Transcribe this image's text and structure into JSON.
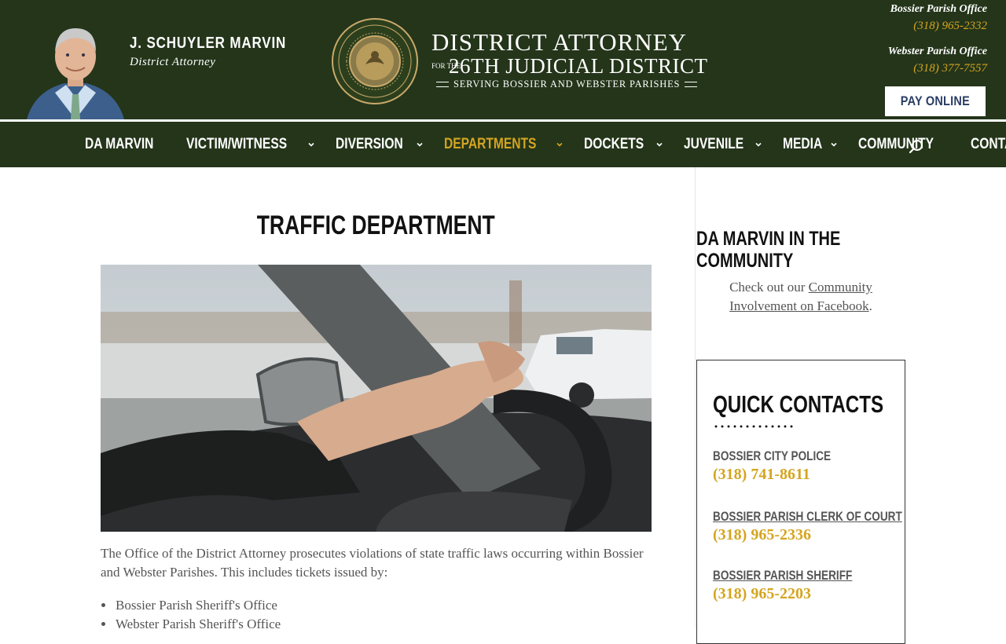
{
  "header": {
    "da_name": "J. SCHUYLER MARVIN",
    "da_title": "District Attorney",
    "logo_line1": "DISTRICT ATTORNEY",
    "logo_for_the": "FOR THE",
    "logo_line2": "26TH JUDICIAL DISTRICT",
    "logo_line3": "SERVING BOSSIER AND WEBSTER PARISHES",
    "offices": [
      {
        "name": "Bossier Parish Office",
        "phone": "(318) 965-2332"
      },
      {
        "name": "Webster Parish Office",
        "phone": "(318) 377-7557"
      }
    ],
    "pay_online": "PAY ONLINE"
  },
  "nav": {
    "items": [
      {
        "label": "DA MARVIN"
      },
      {
        "label": "VICTIM/WITNESS"
      },
      {
        "label": "DIVERSION"
      },
      {
        "label": "DEPARTMENTS"
      },
      {
        "label": "DOCKETS"
      },
      {
        "label": "JUVENILE"
      },
      {
        "label": "MEDIA"
      },
      {
        "label": "COMMUNITY"
      },
      {
        "label": "CONTACT"
      }
    ]
  },
  "main": {
    "title": "TRAFFIC DEPARTMENT",
    "intro": "The Office of the District Attorney prosecutes violations of state traffic laws occurring within Bossier and Webster Parishes. This includes tickets issued by:",
    "list": [
      "Bossier Parish Sheriff's Office",
      "Webster Parish Sheriff's Office"
    ]
  },
  "sidebar": {
    "heading": "DA MARVIN IN THE COMMUNITY",
    "text_before": "Check out our ",
    "link_text": "Community Involvement on Facebook",
    "text_after": ".",
    "quick_contacts_title": "QUICK CONTACTS",
    "contacts": [
      {
        "name": "BOSSIER CITY POLICE",
        "phone": "(318) 741-8611"
      },
      {
        "name": "BOSSIER PARISH CLERK OF COURT",
        "phone": "(318) 965-2336"
      },
      {
        "name": "BOSSIER PARISH SHERIFF",
        "phone": "(318) 965-2203"
      }
    ]
  },
  "colors": {
    "header_green": "#24351a",
    "accent_gold": "#d4a520",
    "button_text": "#2a3d66"
  }
}
